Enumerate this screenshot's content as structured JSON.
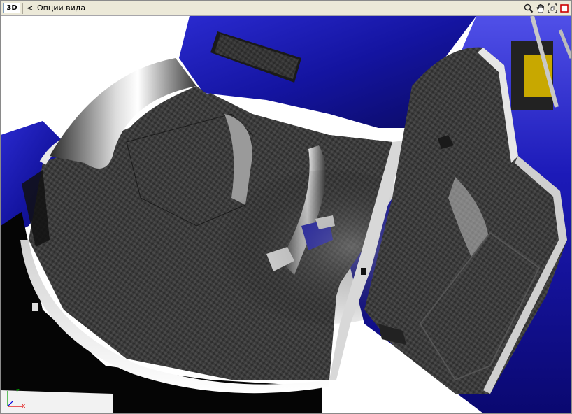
{
  "toolbar": {
    "mode_label": "3D",
    "back_symbol": "<",
    "title": "Опции вида",
    "tools": [
      {
        "icon": "zoom-icon"
      },
      {
        "icon": "pan-hand-icon"
      },
      {
        "icon": "fit-view-icon"
      },
      {
        "icon": "close-view-icon"
      }
    ]
  },
  "axis": {
    "y_label": "z",
    "x_label": "x"
  },
  "colors": {
    "toolbar_bg": "#ece9d8",
    "body_blue": "#1c1ab0",
    "carbon_dark": "#3a3a3a",
    "axis_green": "#00a000",
    "axis_red": "#e00000",
    "close_red": "#cc0000"
  }
}
